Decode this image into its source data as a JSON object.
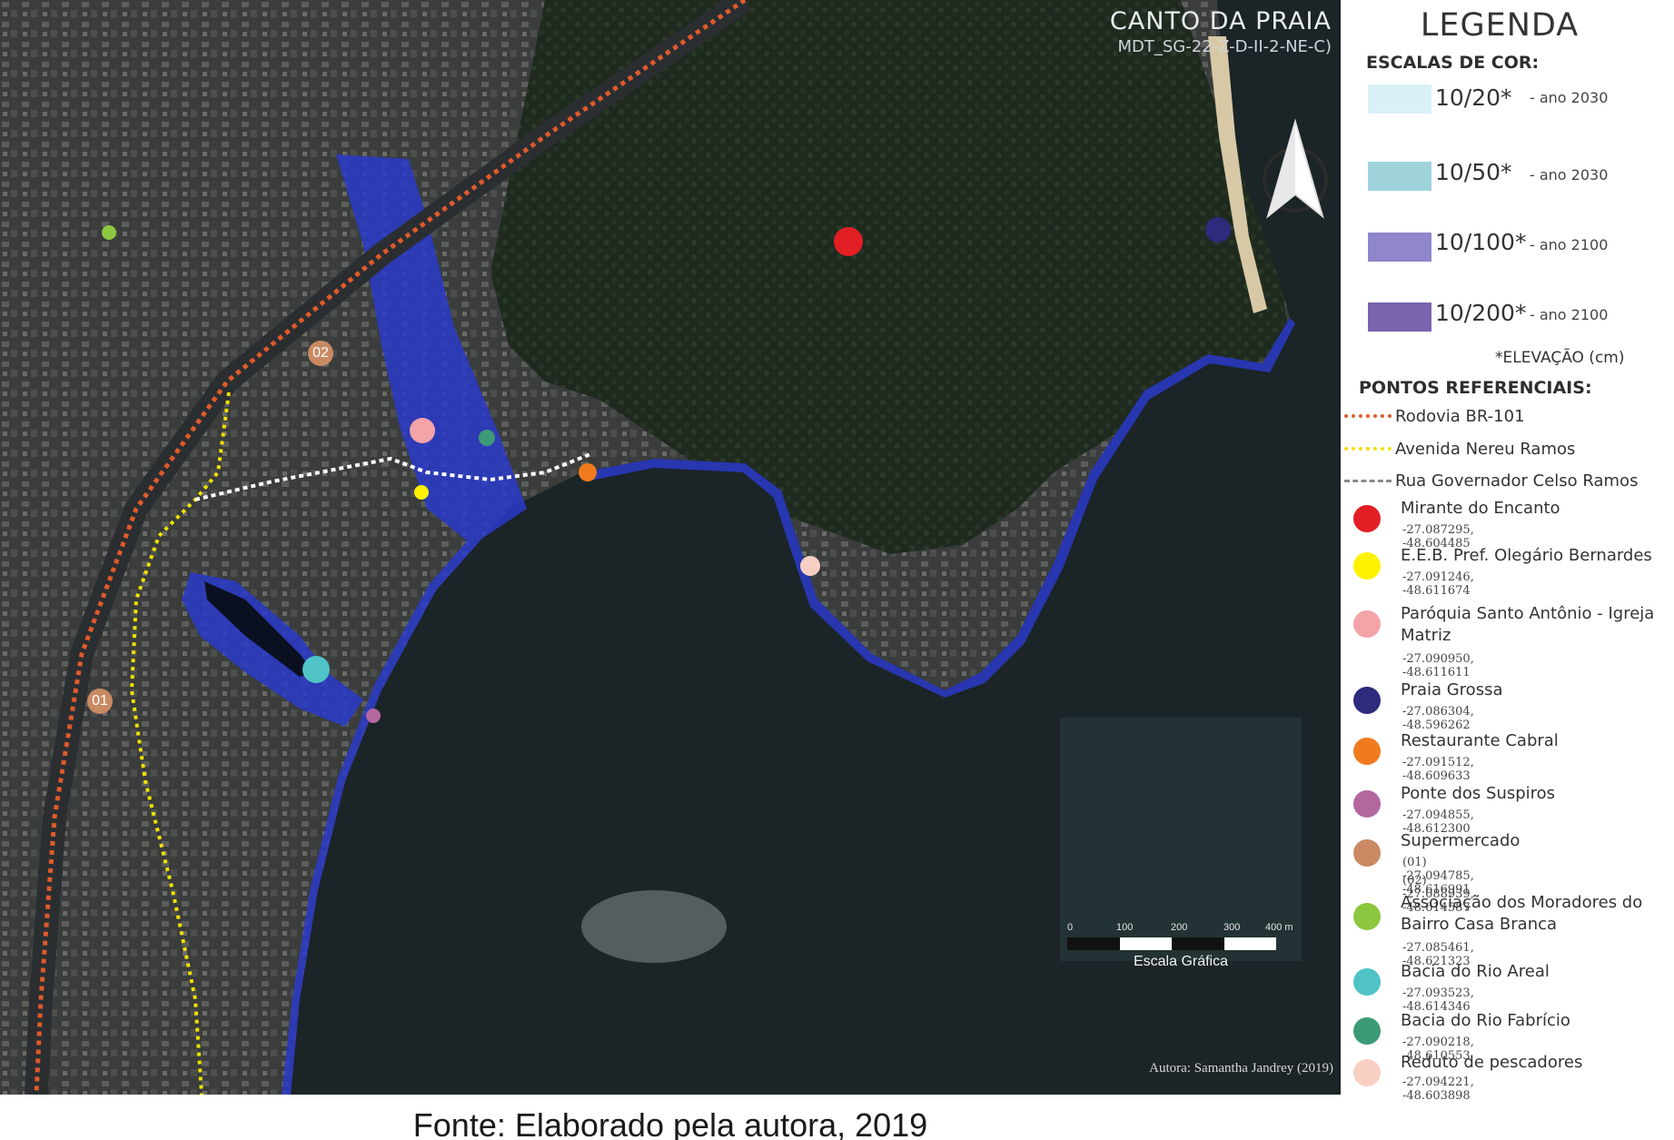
{
  "map": {
    "title": "CANTO DA PRAIA",
    "subtitle": "MDT_SG-22-Z-D-II-2-NE-C)",
    "author": "Autora: Samantha Jandrey (2019)",
    "scale": {
      "ticks": [
        "0",
        "100",
        "200",
        "300",
        "400 m"
      ],
      "caption": "Escala Gráfica"
    },
    "marker_labels": {
      "supermercado_01": "01",
      "supermercado_02": "02"
    }
  },
  "legend": {
    "title": "LEGENDA",
    "color_scales_header": "ESCALAS DE COR:",
    "scales": [
      {
        "value": "10/20*",
        "year": "- ano 2030",
        "color": "#d9f1f6"
      },
      {
        "value": "10/50*",
        "year": "- ano 2030",
        "color": "#9ed3dc"
      },
      {
        "value": "10/100*",
        "year": "- ano 2100",
        "color": "#8f86cc"
      },
      {
        "value": "10/200*",
        "year": "- ano 2100",
        "color": "#7a64ad"
      }
    ],
    "elevation_note": "*ELEVAÇÃO (cm)",
    "ref_points_header": "PONTOS REFERENCIAIS:",
    "lines": [
      {
        "label": "Rodovia BR-101",
        "color": "#e05a2a",
        "style": "dotted"
      },
      {
        "label": "Avenida Nereu Ramos",
        "color": "#f2e100",
        "style": "dotted"
      },
      {
        "label": "Rua Governador Celso Ramos",
        "color": "#8a8a8a",
        "style": "dashed"
      }
    ],
    "points": [
      {
        "name": "Mirante do Encanto",
        "coord": "-27.087295, -48.604485",
        "color": "#e31e24"
      },
      {
        "name": "E.E.B. Pref. Olegário Bernardes",
        "coord": "-27.091246, -48.611674",
        "color": "#fff200"
      },
      {
        "name": "Paróquia Santo Antônio - Igreja Matriz",
        "coord": "-27.090950, -48.611611",
        "color": "#f4a3a8"
      },
      {
        "name": "Praia Grossa",
        "coord": "-27.086304, -48.596262",
        "color": "#2e2a7c"
      },
      {
        "name": "Restaurante Cabral",
        "coord": "-27.091512, -48.609633",
        "color": "#f07b1f"
      },
      {
        "name": "Ponte dos Suspiros",
        "coord": "-27.094855, -48.612300",
        "color": "#b4679f"
      },
      {
        "name": "Supermercado",
        "coord": "(01) -27.094785, -48.616991",
        "coord2": "(02) -27.088939, -48.614587",
        "color": "#c98a63"
      },
      {
        "name": "Associação dos Moradores do Bairro Casa Branca",
        "coord": "-27.085461, -48.621323",
        "color": "#8dc63f"
      },
      {
        "name": "Bacia do Rio Areal",
        "coord": "-27.093523, -48.614346",
        "color": "#4fc3c6"
      },
      {
        "name": "Bacia do Rio Fabrício",
        "coord": "-27.090218, -48.610553",
        "color": "#3c9a77"
      },
      {
        "name": "Reduto de pescadores",
        "coord": "-27.094221, -48.603898",
        "color": "#f9cfc3"
      }
    ]
  },
  "caption": "Fonte: Elaborado pela autora, 2019"
}
